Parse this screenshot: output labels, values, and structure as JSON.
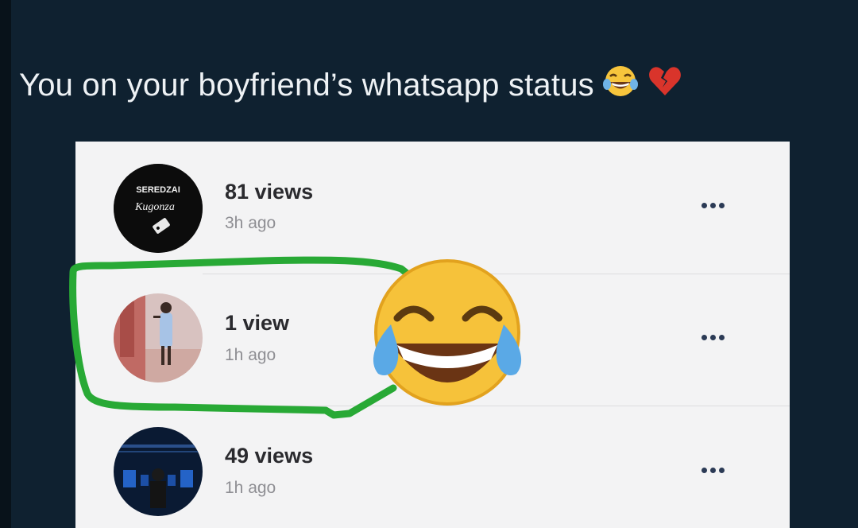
{
  "caption": {
    "text": "You on your boyfriend’s whatsapp status",
    "emoji_icons": [
      "face-with-tears-of-joy-icon",
      "broken-heart-icon"
    ]
  },
  "statuses": [
    {
      "views": "81 views",
      "time": "3h ago",
      "avatar": {
        "line1": "SEREDZAI",
        "line2": "Kugonza"
      }
    },
    {
      "views": "1 view",
      "time": "1h ago",
      "avatar": {}
    },
    {
      "views": "49 views",
      "time": "1h ago",
      "avatar": {}
    }
  ],
  "colors": {
    "background": "#0f2130",
    "card": "#f3f3f4",
    "highlight_circle": "#28a935",
    "more_dots": "#2b3a55"
  }
}
